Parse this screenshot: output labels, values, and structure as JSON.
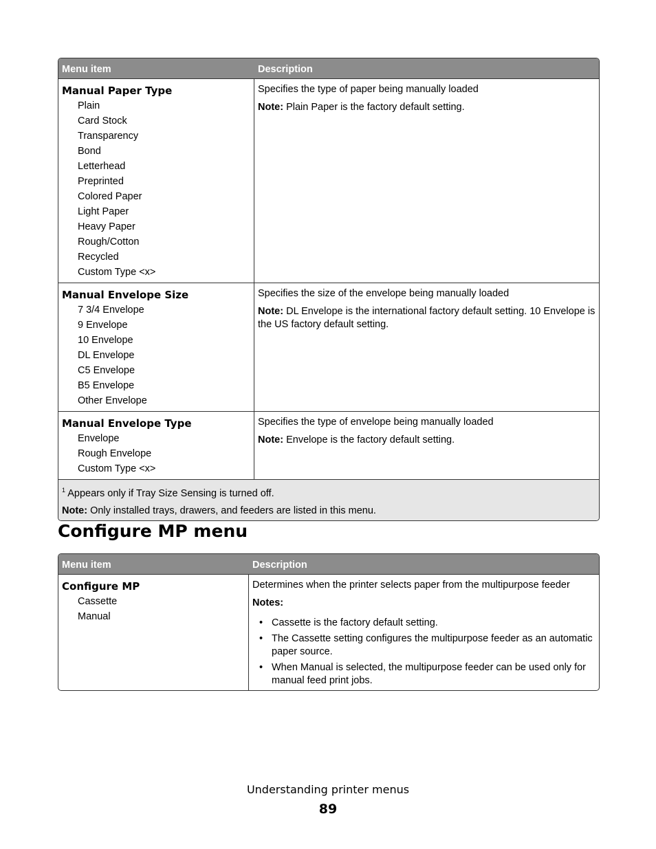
{
  "table1": {
    "headers": [
      "Menu item",
      "Description"
    ],
    "rows": [
      {
        "title": "Manual Paper Type",
        "options": [
          "Plain",
          "Card Stock",
          "Transparency",
          "Bond",
          "Letterhead",
          "Preprinted",
          "Colored Paper",
          "Light Paper",
          "Heavy Paper",
          "Rough/Cotton",
          "Recycled",
          "Custom Type <x>"
        ],
        "description": "Specifies the type of paper being manually loaded",
        "note_label": "Note:",
        "note": " Plain Paper is the factory default setting."
      },
      {
        "title": "Manual Envelope Size",
        "options": [
          "7 3/4 Envelope",
          "9 Envelope",
          "10 Envelope",
          "DL Envelope",
          "C5 Envelope",
          "B5 Envelope",
          "Other Envelope"
        ],
        "description": "Specifies the size of the envelope being manually loaded",
        "note_label": "Note:",
        "note": " DL Envelope is the international factory default setting. 10 Envelope is the US factory default setting."
      },
      {
        "title": "Manual Envelope Type",
        "options": [
          "Envelope",
          "Rough Envelope",
          "Custom Type <x>"
        ],
        "description": "Specifies the type of envelope being manually loaded",
        "note_label": "Note:",
        "note": " Envelope is the factory default setting."
      }
    ],
    "footnote_mark": "1",
    "footnote": " Appears only if Tray Size Sensing is turned off.",
    "foot_note_label": "Note:",
    "foot_note": " Only installed trays, drawers, and feeders are listed in this menu."
  },
  "section_title": "Configure MP menu",
  "table2": {
    "headers": [
      "Menu item",
      "Description"
    ],
    "row": {
      "title": "Configure MP",
      "options": [
        "Cassette",
        "Manual"
      ],
      "description": "Determines when the printer selects paper from the multipurpose feeder",
      "notes_label": "Notes:",
      "notes": [
        "Cassette is the factory default setting.",
        "The Cassette setting configures the multipurpose feeder as an automatic paper source.",
        "When Manual is selected, the multipurpose feeder can be used only for manual feed print jobs."
      ]
    }
  },
  "footer": {
    "chapter": "Understanding printer menus",
    "page": "89"
  }
}
